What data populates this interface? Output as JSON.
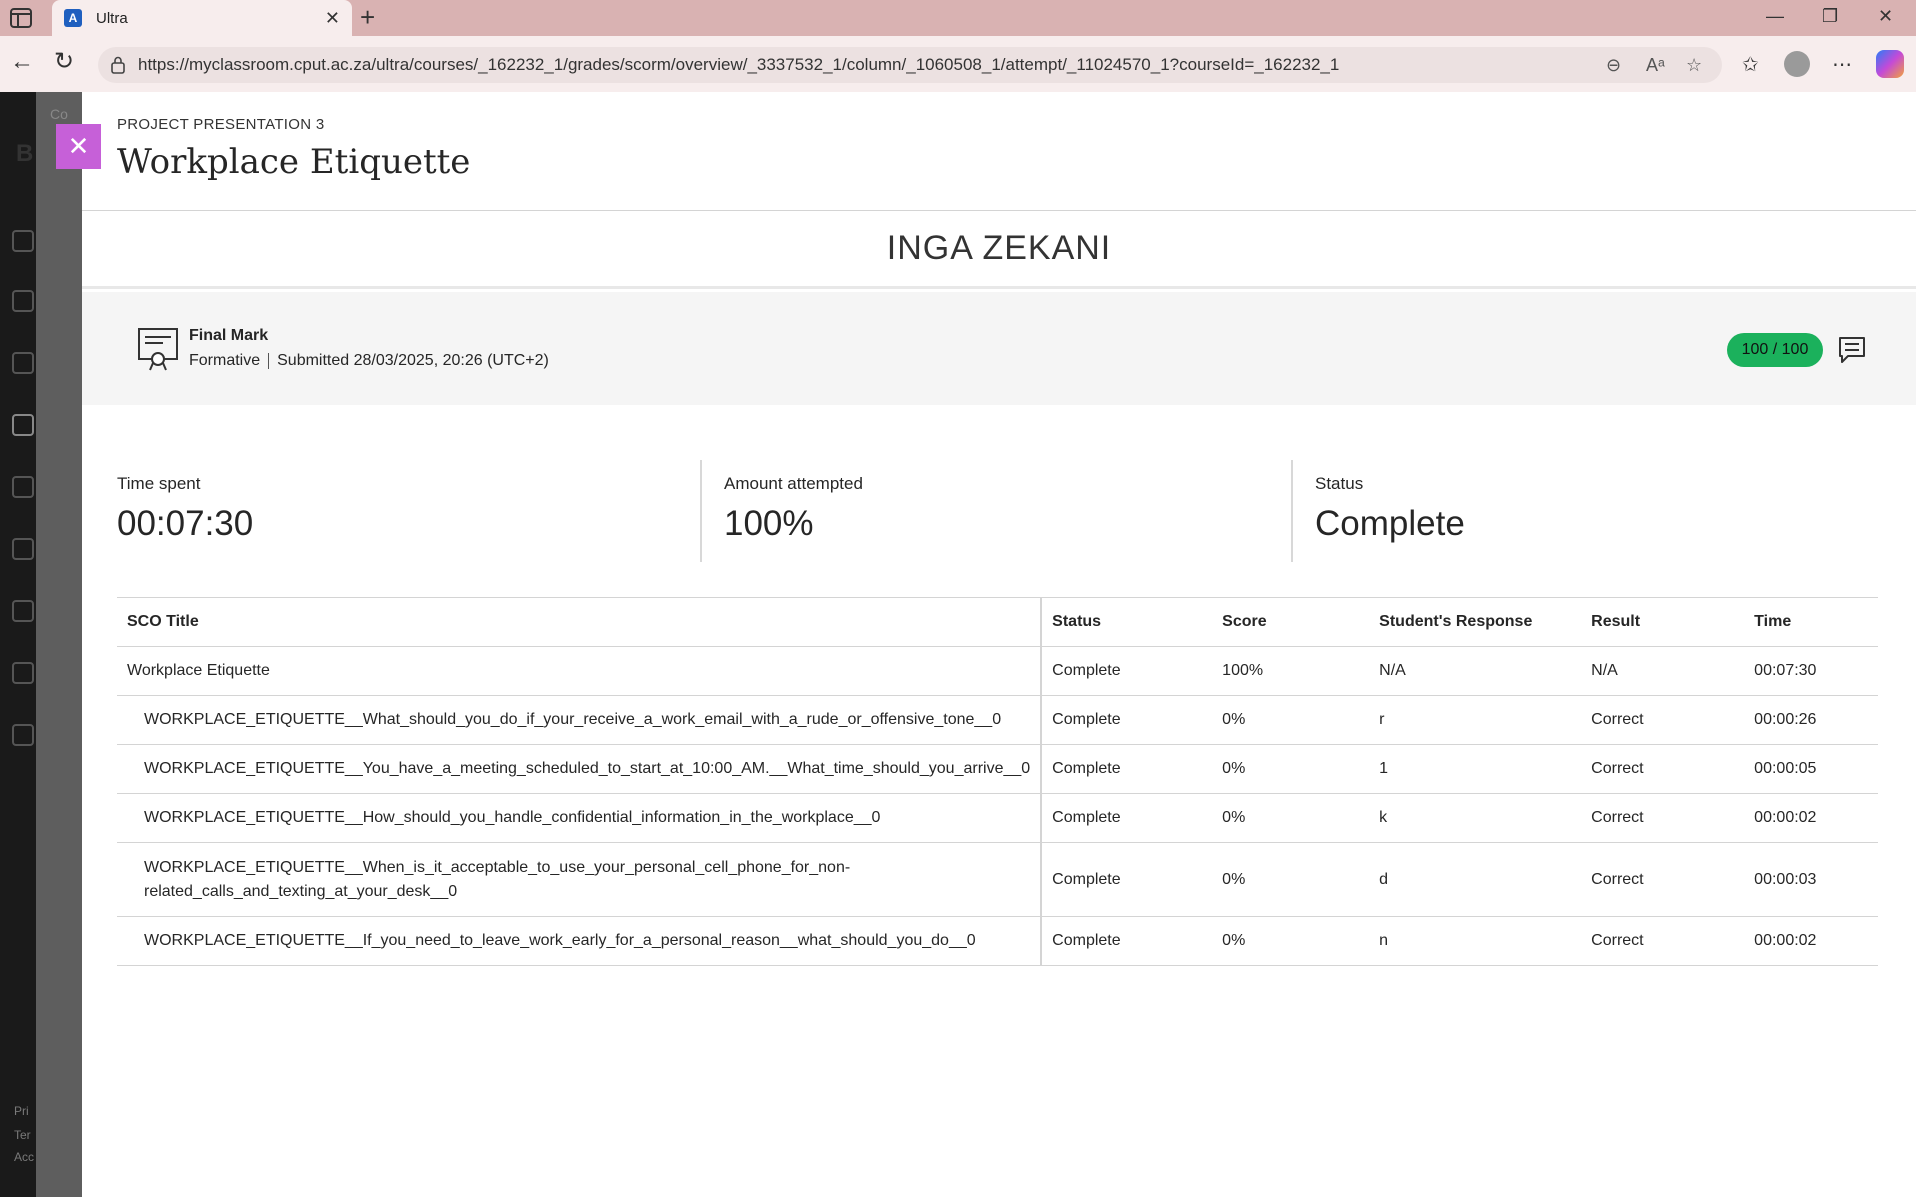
{
  "browser": {
    "tab_title": "Ultra",
    "tab_favicon_letter": "A",
    "url": "https://myclassroom.cput.ac.za/ultra/courses/_162232_1/grades/scorm/overview/_3337532_1/column/_1060508_1/attempt/_11024570_1?courseId=_162232_1",
    "icons": [
      "sidebar-icon",
      "close-icon",
      "plus-icon",
      "minimize-icon",
      "restore-icon",
      "close-icon",
      "back-icon",
      "refresh-icon",
      "lock-icon",
      "zoom-out-icon",
      "read-aloud-icon",
      "star-icon",
      "favorites-icon",
      "profile-icon",
      "more-icon",
      "copilot-icon"
    ]
  },
  "background": {
    "strip_texts": [
      "Co",
      "B",
      "Pri",
      "Ter",
      "Acc"
    ]
  },
  "header": {
    "overline": "PROJECT PRESENTATION 3",
    "title": "Workplace Etiquette"
  },
  "student": {
    "name": "INGA ZEKANI"
  },
  "final_mark": {
    "label": "Final Mark",
    "category": "Formative",
    "submitted": "Submitted 28/03/2025, 20:26 (UTC+2)",
    "score": "100 / 100",
    "score_color": "#1bb15c"
  },
  "stats": {
    "time_spent_label": "Time spent",
    "time_spent_value": "00:07:30",
    "amount_label": "Amount attempted",
    "amount_value": "100%",
    "status_label": "Status",
    "status_value": "Complete"
  },
  "table": {
    "headers": {
      "title": "SCO Title",
      "status": "Status",
      "score": "Score",
      "response": "Student's Response",
      "result": "Result",
      "time": "Time"
    },
    "rows": [
      {
        "title": "Workplace Etiquette",
        "status": "Complete",
        "score": "100%",
        "response": "N/A",
        "result": "N/A",
        "time": "00:07:30"
      },
      {
        "title": "WORKPLACE_ETIQUETTE__What_should_you_do_if_your_receive_a_work_email_with_a_rude_or_offensive_tone__0",
        "status": "Complete",
        "score": "0%",
        "response": "r",
        "result": "Correct",
        "time": "00:00:26"
      },
      {
        "title": "WORKPLACE_ETIQUETTE__You_have_a_meeting_scheduled_to_start_at_10:00_AM.__What_time_should_you_arrive__0",
        "status": "Complete",
        "score": "0%",
        "response": "1",
        "result": "Correct",
        "time": "00:00:05"
      },
      {
        "title": "WORKPLACE_ETIQUETTE__How_should_you_handle_confidential_information_in_the_workplace__0",
        "status": "Complete",
        "score": "0%",
        "response": "k",
        "result": "Correct",
        "time": "00:00:02"
      },
      {
        "title_line1": "WORKPLACE_ETIQUETTE__When_is_it_acceptable_to_use_your_personal_cell_phone_for_non-",
        "title_line2": "related_calls_and_texting_at_your_desk__0",
        "status": "Complete",
        "score": "0%",
        "response": "d",
        "result": "Correct",
        "time": "00:00:03"
      },
      {
        "title": "WORKPLACE_ETIQUETTE__If_you_need_to_leave_work_early_for_a_personal_reason__what_should_you_do__0",
        "status": "Complete",
        "score": "0%",
        "response": "n",
        "result": "Correct",
        "time": "00:00:02"
      }
    ]
  }
}
